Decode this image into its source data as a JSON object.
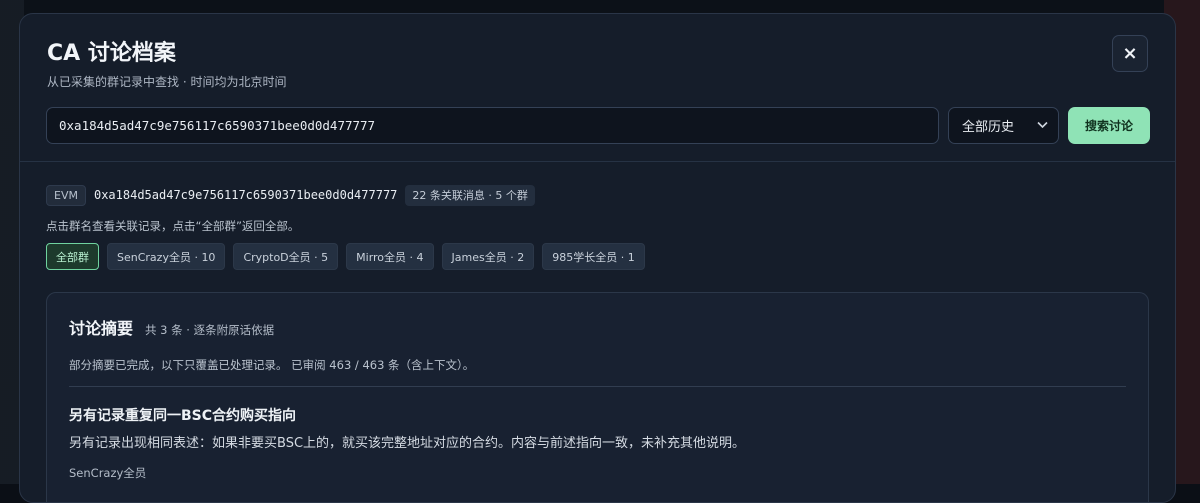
{
  "modal": {
    "title": "CA 讨论档案",
    "subtitle": "从已采集的群记录中查找 · 时间均为北京时间",
    "close_label": "×"
  },
  "search": {
    "value": "0xa184d5ad47c9e756117c6590371bee0d0d477777",
    "range_selected": "全部历史",
    "button_label": "搜索讨论"
  },
  "result": {
    "chain": "EVM",
    "address": "0xa184d5ad47c9e756117c6590371bee0d0d477777",
    "count_label": "22 条关联消息 · 5 个群",
    "hint": "点击群名查看关联记录，点击“全部群”返回全部。",
    "chips": [
      {
        "label": "全部群",
        "active": true
      },
      {
        "label": "SenCrazy全员 · 10",
        "active": false
      },
      {
        "label": "CryptoD全员 · 5",
        "active": false
      },
      {
        "label": "Mirro全员 · 4",
        "active": false
      },
      {
        "label": "James全员 · 2",
        "active": false
      },
      {
        "label": "985学长全员 · 1",
        "active": false
      }
    ]
  },
  "summary": {
    "title": "讨论摘要",
    "meta": "共 3 条 · 逐条附原话依据",
    "status": "部分摘要已完成，以下只覆盖已处理记录。 已审阅 463 / 463 条（含上下文）。",
    "item": {
      "title": "另有记录重复同一BSC合约购买指向",
      "text": "另有记录出现相同表述：如果非要买BSC上的，就买该完整地址对应的合约。内容与前述指向一致，未补充其他说明。",
      "source": "SenCrazy全员"
    }
  },
  "colors": {
    "accent": "#8fe3b6",
    "active_chip_border": "#6fd39f",
    "panel": "#151d2a"
  },
  "icons": {
    "close": "close-icon",
    "select": "chevron-down-icon"
  }
}
